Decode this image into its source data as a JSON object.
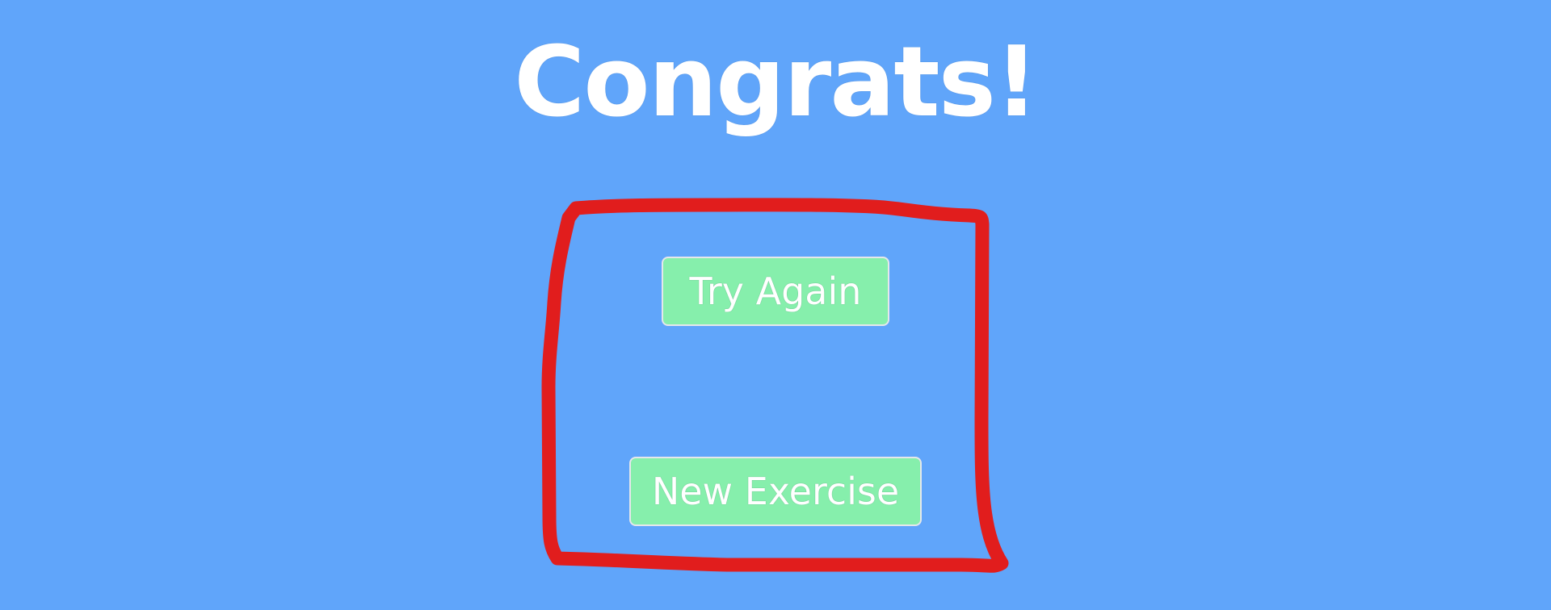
{
  "heading": {
    "title": "Congrats!"
  },
  "actions": {
    "try_again_label": "Try Again",
    "new_exercise_label": "New Exercise"
  },
  "colors": {
    "background": "#60a5fa",
    "button_fill": "#86efac",
    "button_border": "#e5e7eb",
    "text": "#ffffff",
    "annotation_stroke": "#e11d1d"
  },
  "annotation": {
    "shape": "hand-drawn-rectangle"
  }
}
